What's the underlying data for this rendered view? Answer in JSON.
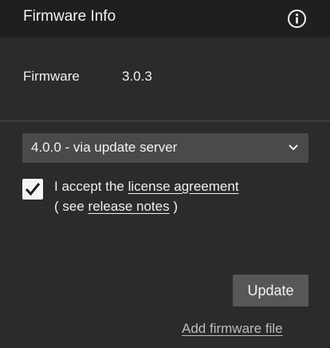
{
  "header": {
    "title": "Firmware Info",
    "info_icon": "info-circle-icon"
  },
  "firmware": {
    "label": "Firmware",
    "version": "3.0.3"
  },
  "update_source": {
    "selected": "4.0.0 - via update server",
    "dropdown_icon": "chevron-down-icon"
  },
  "license": {
    "checked": true,
    "accept_prefix": "I accept the ",
    "license_link": "license agreement",
    "notes_prefix": "( see ",
    "notes_link": "release notes",
    "notes_suffix": " )"
  },
  "actions": {
    "update_label": "Update",
    "add_firmware_label": "Add firmware file"
  },
  "colors": {
    "panel_bg": "#2b2b2b",
    "header_bg": "#1f1f1f",
    "select_bg": "#4a4a4a",
    "button_bg": "#575757"
  }
}
